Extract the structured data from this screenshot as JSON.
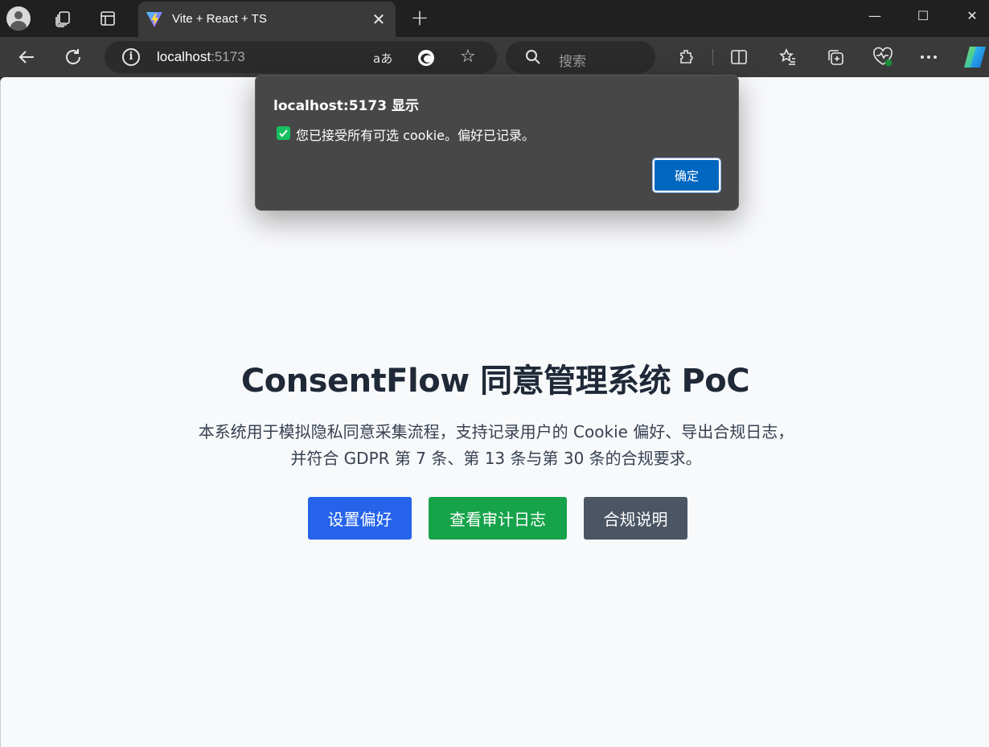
{
  "browser": {
    "tab": {
      "title": "Vite + React + TS",
      "close_glyph": "✕"
    },
    "new_tab_glyph": "+",
    "window_controls": {
      "minimize": "—",
      "maximize": "☐",
      "close": "✕"
    },
    "address": {
      "host": "localhost",
      "port": ":5173",
      "read_aloud": "aあ"
    },
    "search": {
      "placeholder": "搜索"
    },
    "icons": [
      "profile-icon",
      "workspaces-icon",
      "tab-actions-icon",
      "vite-favicon",
      "back-icon",
      "refresh-icon",
      "site-info-icon",
      "read-aloud-icon",
      "edge-icon",
      "favorite-star-icon",
      "search-icon",
      "extensions-icon",
      "split-screen-icon",
      "favorites-icon",
      "collections-icon",
      "browser-essentials-icon",
      "more-icon",
      "copilot-icon"
    ]
  },
  "page": {
    "title": "ConsentFlow 同意管理系统 PoC",
    "description": "本系统用于模拟隐私同意采集流程，支持记录用户的 Cookie 偏好、导出合规日志，并符合 GDPR 第 7 条、第 13 条与第 30 条的合规要求。",
    "buttons": {
      "preferences": "设置偏好",
      "audit_log": "查看审计日志",
      "compliance": "合规说明"
    },
    "colors": {
      "blue": "#2563eb",
      "green": "#16a34a",
      "gray": "#4b5563"
    }
  },
  "dialog": {
    "title": "localhost:5173 显示",
    "message": "您已接受所有可选 cookie。偏好已记录。",
    "ok_label": "确定"
  }
}
